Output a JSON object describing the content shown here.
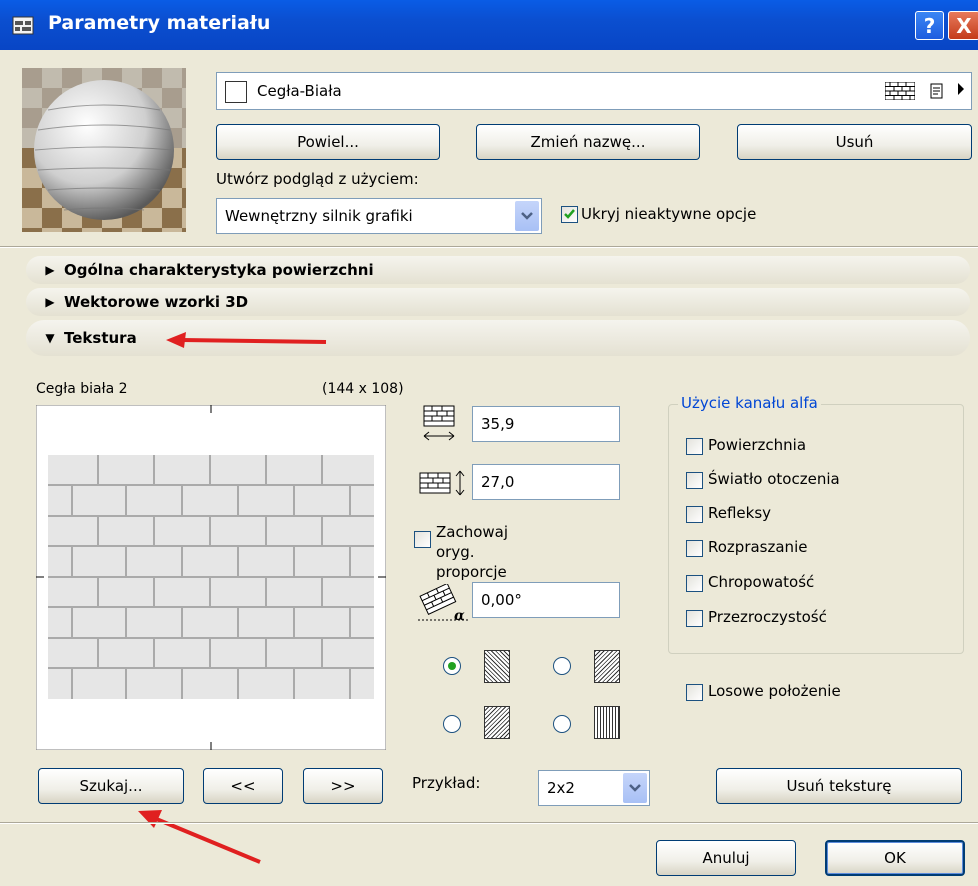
{
  "window": {
    "title": "Parametry materiału",
    "help_label": "?",
    "close_label": "X"
  },
  "material": {
    "name": "Cegła-Biała",
    "duplicate_label": "Powiel...",
    "rename_label": "Zmień nazwę...",
    "delete_label": "Usuń",
    "preview_with_label": "Utwórz podgląd z użyciem:",
    "engine_value": "Wewnętrzny silnik grafiki",
    "hide_inactive_label": "Ukryj nieaktywne opcje",
    "hide_inactive_checked": true
  },
  "sections": [
    {
      "label": "Ogólna charakterystyka powierzchni",
      "expanded": false
    },
    {
      "label": "Wektorowe wzorki 3D",
      "expanded": false
    },
    {
      "label": "Tekstura",
      "expanded": true
    }
  ],
  "texture": {
    "name": "Cegła biała 2",
    "size": "(144 x 108)",
    "width": "35,9",
    "height": "27,0",
    "keep_proportions_label": "Zachowaj oryg. proporcje",
    "keep_proportions_checked": false,
    "angle": "0,00°",
    "search_label": "Szukaj...",
    "prev_label": "<<",
    "next_label": ">>",
    "example_label": "Przykład:",
    "example_value": "2x2",
    "remove_label": "Usuń teksturę",
    "random_label": "Losowe położenie",
    "random_checked": false,
    "alpha_group_label": "Użycie kanału alfa",
    "alpha_options": [
      {
        "label": "Powierzchnia",
        "checked": false
      },
      {
        "label": "Światło otoczenia",
        "checked": false
      },
      {
        "label": "Refleksy",
        "checked": false
      },
      {
        "label": "Rozpraszanie",
        "checked": false
      },
      {
        "label": "Chropowatość",
        "checked": false
      },
      {
        "label": "Przezroczystość",
        "checked": false
      }
    ],
    "mirror_selected_index": 0
  },
  "footer": {
    "cancel_label": "Anuluj",
    "ok_label": "OK"
  },
  "colors": {
    "titlebar": "#0b4fd0",
    "dialog_bg": "#ece9d8",
    "annotation_arrow": "#e02020"
  }
}
